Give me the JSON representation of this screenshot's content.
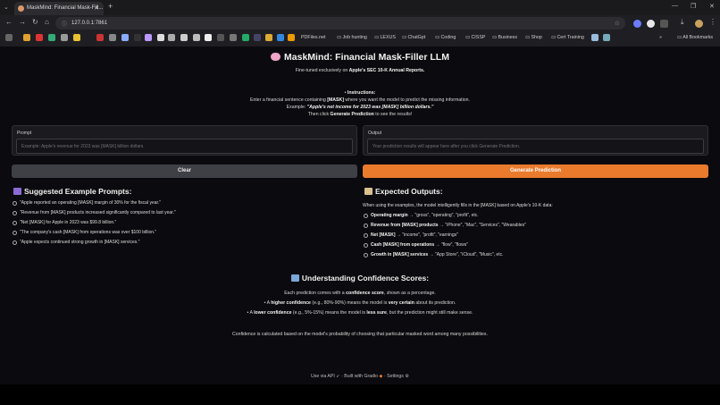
{
  "browser": {
    "tab_title": "MaskMind: Financial Mask-Fill...",
    "url": "127.0.0.1:7861",
    "bookmarks": [
      "PDFiles.net",
      "Job hunting",
      "LEXUS",
      "ChatGpt",
      "Coding",
      "CISSP",
      "Business",
      "Shop",
      "Cert Training"
    ],
    "all_bookmarks": "All Bookmarks"
  },
  "header": {
    "title": "MaskMind: Financial Mask-Filler LLM",
    "subtitle_prefix": "Fine-tuned exclusively on ",
    "subtitle_bold": "Apple's SEC 10-K Annual Reports."
  },
  "instructions": {
    "heading": "Instructions:",
    "line1_a": "Enter a financial sentence containing ",
    "line1_b": "[MASK]",
    "line1_c": " where you want the model to predict the missing information.",
    "line2_a": "Example: ",
    "line2_b": "\"Apple's net income for 2023 was [MASK] billion dollars.\"",
    "line3_a": "Then click ",
    "line3_b": "Generate Prediction",
    "line3_c": " to see the results!"
  },
  "prompt": {
    "label": "Prompt",
    "placeholder": "Example: Apple's revenue for 2023 was [MASK] billion dollars."
  },
  "output": {
    "label": "Output",
    "placeholder": "Your prediction results will appear here after you click Generate Prediction."
  },
  "buttons": {
    "clear": "Clear",
    "generate": "Generate Prediction"
  },
  "suggested": {
    "heading": "Suggested Example Prompts:",
    "items": [
      "\"Apple reported an operating [MASK] margin of 30% for the fiscal year.\"",
      "\"Revenue from [MASK] products increased significantly compared to last year.\"",
      "\"Net [MASK] for Apple in 2023 was $99.8 billion.\"",
      "\"The company's cash [MASK] from operations was over $100 billion.\"",
      "\"Apple expects continued strong growth in [MASK] services.\""
    ]
  },
  "expected": {
    "heading": "Expected Outputs:",
    "intro": "When using the examples, the model intelligently fills in the [MASK] based on Apple's 10-K data:",
    "items": [
      {
        "bold": "Operating margin",
        "rest": " → \"gross\", \"operating\", \"profit\", etc."
      },
      {
        "bold": "Revenue from [MASK] products",
        "rest": " → \"iPhone\", \"Mac\", \"Services\", \"Wearables\""
      },
      {
        "bold": "Net [MASK]",
        "rest": " → \"income\", \"profit\", \"earnings\""
      },
      {
        "bold": "Cash [MASK] from operations",
        "rest": " → \"flow\", \"flows\""
      },
      {
        "bold": "Growth in [MASK] services",
        "rest": " → \"App Store\", \"iCloud\", \"Music\", etc."
      }
    ]
  },
  "confidence": {
    "heading": "Understanding Confidence Scores:",
    "line1_a": "Each prediction comes with a ",
    "line1_b": "confidence score",
    "line1_c": ", shown as a percentage.",
    "bullet1_a": "A ",
    "bullet1_b": "higher confidence",
    "bullet1_c": " (e.g., 80%-90%) means the model is ",
    "bullet1_d": "very certain",
    "bullet1_e": " about its prediction.",
    "bullet2_a": "A ",
    "bullet2_b": "lower confidence",
    "bullet2_c": " (e.g., 5%-15%) means the model is ",
    "bullet2_d": "less sure",
    "bullet2_e": ", but the prediction might still make sense.",
    "note": "Confidence is calculated based on the model's probability of choosing that particular masked word among many possibilities."
  },
  "footer": {
    "api": "Use via API",
    "built": "Built with Gradio",
    "settings": "Settings",
    "sep": "·"
  },
  "colors": {
    "accent_orange": "#ea7b2c",
    "button_gray": "#3f3f46",
    "background": "#0b0b0f"
  }
}
